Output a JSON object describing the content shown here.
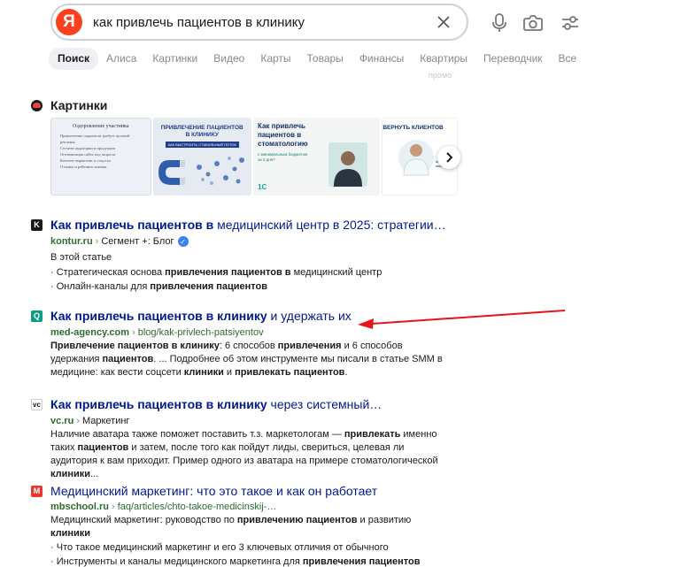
{
  "search": {
    "logo_letter": "Я",
    "query": "как привлечь пациентов в клинику"
  },
  "tabs": [
    "Поиск",
    "Алиса",
    "Картинки",
    "Видео",
    "Карты",
    "Товары",
    "Финансы",
    "Квартиры",
    "Переводчик",
    "Все"
  ],
  "promo": "промо",
  "images": {
    "title": "Картинки",
    "thumbs": [
      {
        "title": "Оздоровление участника",
        "lines": [
          "Привлечение пациентов требует целевой рекламы",
          "Сегмент аудитории и продукция",
          "Оптимизация сайта под запросы",
          "Контент-маркетинг и соцсети",
          "Отзывы и рейтинги клиник"
        ]
      },
      {
        "title": "ПРИВЛЕЧЕНИЕ ПАЦИЕНТОВ В КЛИНИКУ",
        "subtitle": "КАК ВЫСТРОИТЬ СТАБИЛЬНЫЙ ПОТОК"
      },
      {
        "title": "Как привлечь пациентов в стоматологию",
        "subtitle": "с минимальным бюджетом за 3 дня?",
        "badge": "1С"
      },
      {
        "title": "ВЕРНУТЬ КЛИЕНТОВ"
      }
    ]
  },
  "results": [
    {
      "favicon": "K",
      "title_bold": "Как привлечь пациентов в",
      "title_rest": " медицинский центр в 2025: стратегии…",
      "host": "kontur.ru",
      "path": "Сегмент +: Блог",
      "verified": true,
      "intro": "В этой статье",
      "bullets": [
        {
          "pre": "Стратегическая основа ",
          "bold": "привлечения пациентов в",
          "post": " медицинский центр"
        },
        {
          "pre": "Онлайн-каналы для ",
          "bold": "привлечения пациентов",
          "post": ""
        }
      ]
    },
    {
      "favicon": "Q",
      "title_bold": "Как привлечь пациентов в клинику",
      "title_rest": " и удержать их",
      "host": "med-agency.com",
      "path": "blog/kak-privlech-patsiyentov",
      "body": [
        {
          "b": "Привлечение пациентов в клинику"
        },
        {
          "t": ": 6 способов "
        },
        {
          "b": "привлечения"
        },
        {
          "t": " и 6 способов удержания "
        },
        {
          "b": "пациентов"
        },
        {
          "t": ". ... Подробнее об этом инструменте мы писали в статье SMM в медицине: как вести соцсети "
        },
        {
          "b": "клиники"
        },
        {
          "t": " и "
        },
        {
          "b": "привлекать пациентов"
        },
        {
          "t": "."
        }
      ]
    },
    {
      "favicon": "vc",
      "title_bold": "Как привлечь пациентов в клинику",
      "title_rest": " через системный…",
      "host": "vc.ru",
      "path": "Маркетинг",
      "body": [
        {
          "t": "Наличие аватара также поможет поставить т.з. маркетологам — "
        },
        {
          "b": "привлекать"
        },
        {
          "t": " именно таких "
        },
        {
          "b": "пациентов"
        },
        {
          "t": " и затем, после того как пойдут лиды, свериться, целевая ли аудитория к вам приходит. Пример одного из аватара на примере стоматологической "
        },
        {
          "b": "клиники"
        },
        {
          "t": "..."
        }
      ]
    },
    {
      "favicon": "M",
      "title_bold": "",
      "title_rest": "Медицинский маркетинг: что это такое и как он работает",
      "host": "mbschool.ru",
      "path": "faq/articles/chto-takoe-medicinskij-…",
      "body": [
        {
          "t": "Медицинский маркетинг: руководство по "
        },
        {
          "b": "привлечению пациентов"
        },
        {
          "t": " и развитию "
        },
        {
          "b": "клиники"
        }
      ],
      "bullets": [
        {
          "pre": "Что такое медицинский маркетинг и его 3 ключевых отличия от обычного",
          "bold": "",
          "post": ""
        },
        {
          "pre": "Инструменты и каналы медицинского маркетинга для ",
          "bold": "привлечения пациентов",
          "post": ""
        }
      ]
    }
  ],
  "colors": {
    "accent": "#fc3f1d",
    "link": "#001a8c",
    "url": "#2d6b2e",
    "arrow": "#e8141b"
  }
}
